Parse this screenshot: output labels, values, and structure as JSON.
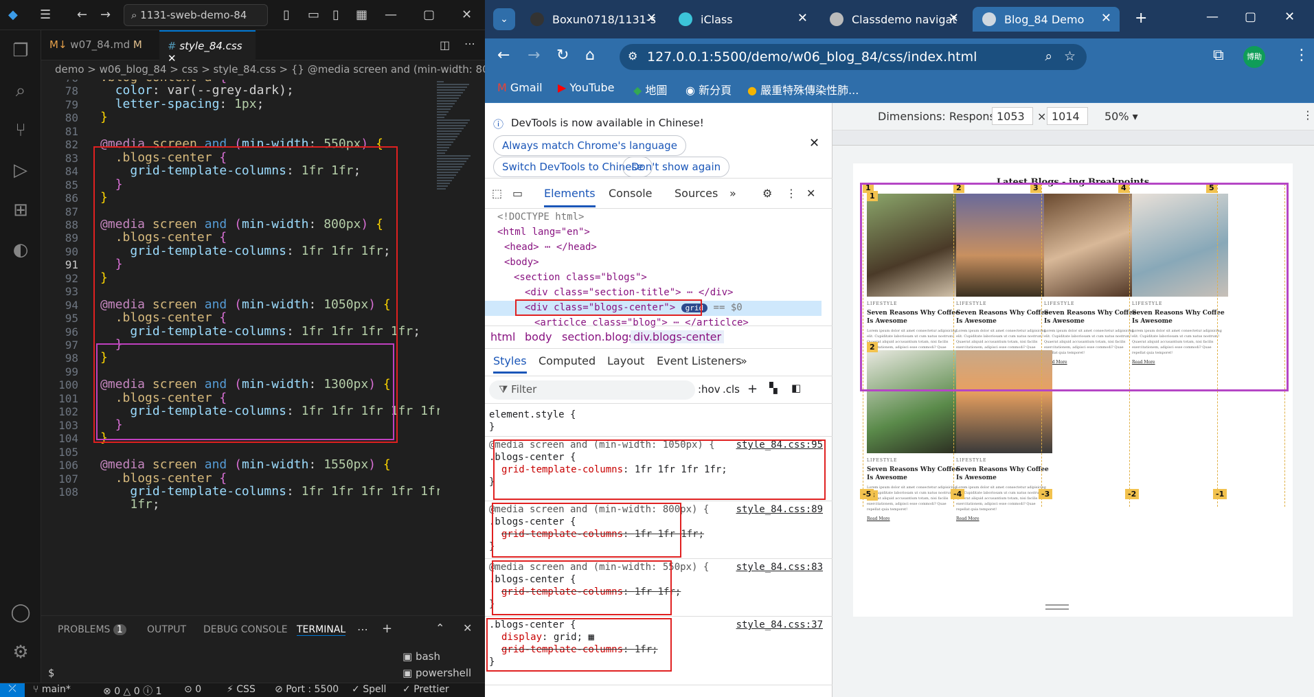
{
  "vscode": {
    "search": "1131-sweb-demo-84",
    "tabs": [
      {
        "label": "w07_84.md",
        "badge": "M"
      },
      {
        "label": "style_84.css"
      }
    ],
    "breadcrumb": "demo > w06_blog_84 > css > style_84.css > {} @media screen and (min-width: 800",
    "panel_tabs": [
      "PROBLEMS",
      "OUTPUT",
      "DEBUG CONSOLE",
      "TERMINAL"
    ],
    "problems_count": "1",
    "terminals": [
      "bash",
      "powershell"
    ],
    "prompt": "$",
    "status": {
      "branch": "main*",
      "errors": "0",
      "warnings": "0",
      "info": "1",
      "ports": "0",
      "lang": "CSS",
      "port": "Port : 5500",
      "spell": "Spell",
      "prettier": "Prettier"
    }
  },
  "code_lines": [
    {
      "n": "76",
      "t": ".blog-content a {"
    },
    {
      "n": "78",
      "t": "  color: var(--grey-dark);"
    },
    {
      "n": "79",
      "t": "  letter-spacing: 1px;"
    },
    {
      "n": "80",
      "t": "}"
    },
    {
      "n": "81",
      "t": ""
    },
    {
      "n": "82",
      "t": "@media screen and (min-width: 550px) {"
    },
    {
      "n": "83",
      "t": "  .blogs-center {"
    },
    {
      "n": "84",
      "t": "    grid-template-columns: 1fr 1fr;"
    },
    {
      "n": "85",
      "t": "  }"
    },
    {
      "n": "86",
      "t": "}"
    },
    {
      "n": "87",
      "t": ""
    },
    {
      "n": "88",
      "t": "@media screen and (min-width: 800px) {"
    },
    {
      "n": "89",
      "t": "  .blogs-center {"
    },
    {
      "n": "90",
      "t": "    grid-template-columns: 1fr 1fr 1fr;"
    },
    {
      "n": "91",
      "t": "  }"
    },
    {
      "n": "92",
      "t": "}"
    },
    {
      "n": "93",
      "t": ""
    },
    {
      "n": "94",
      "t": "@media screen and (min-width: 1050px) {"
    },
    {
      "n": "95",
      "t": "  .blogs-center {"
    },
    {
      "n": "96",
      "t": "    grid-template-columns: 1fr 1fr 1fr 1fr;"
    },
    {
      "n": "97",
      "t": "  }"
    },
    {
      "n": "98",
      "t": "}"
    },
    {
      "n": "99",
      "t": ""
    },
    {
      "n": "100",
      "t": "@media screen and (min-width: 1300px) {"
    },
    {
      "n": "101",
      "t": "  .blogs-center {"
    },
    {
      "n": "102",
      "t": "    grid-template-columns: 1fr 1fr 1fr 1fr 1fr;"
    },
    {
      "n": "103",
      "t": "  }"
    },
    {
      "n": "104",
      "t": "}"
    },
    {
      "n": "105",
      "t": ""
    },
    {
      "n": "106",
      "t": "@media screen and (min-width: 1550px) {"
    },
    {
      "n": "107",
      "t": "  .blogs-center {"
    },
    {
      "n": "108",
      "t": "    grid-template-columns: 1fr 1fr 1fr 1fr 1fr"
    },
    {
      "n": "",
      "t": "    1fr;"
    }
  ],
  "chrome": {
    "tabs": [
      "Boxun0718/1131-s",
      "iClass",
      "Classdemo navigat",
      "Blog_84 Demo"
    ],
    "url": "127.0.0.1:5500/demo/w06_blog_84/css/index.html",
    "bookmarks": [
      "Gmail",
      "YouTube",
      "地圖",
      "新分頁",
      "嚴重特殊傳染性肺..."
    ],
    "profile": "博勛"
  },
  "devtools": {
    "banner": "DevTools is now available in Chinese!",
    "btn_match": "Always match Chrome's language",
    "btn_switch": "Switch DevTools to Chinese",
    "btn_dont": "Don't show again",
    "tabs": [
      "Elements",
      "Console",
      "Sources"
    ],
    "dom": [
      "<!DOCTYPE html>",
      "<html lang=\"en\">",
      "<head> ⋯ </head>",
      "<body>",
      "<section class=\"blogs\">",
      "<div class=\"section-title\"> ⋯ </div>",
      "<div class=\"blogs-center\">",
      "<articlce class=\"blog\"> ⋯ </articlce>"
    ],
    "grid_badge": "grid",
    "eq0": "== $0",
    "crumbs": [
      "html",
      "body",
      "section.blogs",
      "div.blogs-center"
    ],
    "style_tabs": [
      "Styles",
      "Computed",
      "Layout",
      "Event Listeners"
    ],
    "filter": "Filter",
    "hov": ":hov",
    "cls": ".cls",
    "rules": [
      {
        "media": "",
        "sel": "element.style {",
        "prop": "",
        "val": "",
        "src": "",
        "struck": false
      },
      {
        "media": "@media screen and (min-width: 1050px) {",
        "sel": ".blogs-center {",
        "prop": "grid-template-columns",
        "val": "1fr 1fr 1fr 1fr;",
        "src": "style_84.css:95",
        "struck": false
      },
      {
        "media": "@media screen and (min-width: 800px) {",
        "sel": ".blogs-center {",
        "prop": "grid-template-columns",
        "val": "1fr 1fr 1fr;",
        "src": "style_84.css:89",
        "struck": true
      },
      {
        "media": "@media screen and (min-width: 550px) {",
        "sel": ".blogs-center {",
        "prop": "grid-template-columns",
        "val": "1fr 1fr;",
        "src": "style_84.css:83",
        "struck": true
      },
      {
        "media": "",
        "sel": ".blogs-center {",
        "prop": "display",
        "val": "grid;",
        "src": "style_84.css:37",
        "struck": false,
        "extra_prop": "grid-template-columns",
        "extra_val": "1fr;"
      }
    ]
  },
  "viewport": {
    "dimensions_label": "Dimensions: Responsive",
    "width": "1053",
    "height": "1014",
    "zoom": "50%",
    "page_title": "Latest Blogs - ing Breakpoints",
    "card_category": "LIFESTYLE",
    "card_title": "Seven Reasons Why Coffee Is Awesome",
    "card_body": "Lorem ipsum dolor sit amet consectetur adipisicing elit. Cupiditate laboriosam ut cum natus nostrum! Quaerat aliquid accusantium totam, nisi facilis exercitationem, adipisci esse commodi? Quae repellat quia temporet!",
    "card_more": "Read More",
    "grid_labels_top": [
      "1",
      "2",
      "3",
      "4",
      "5"
    ],
    "grid_labels_row": [
      "1",
      "2",
      "3"
    ],
    "grid_labels_neg": [
      "-5",
      "-4",
      "-3",
      "-2",
      "-1"
    ]
  }
}
